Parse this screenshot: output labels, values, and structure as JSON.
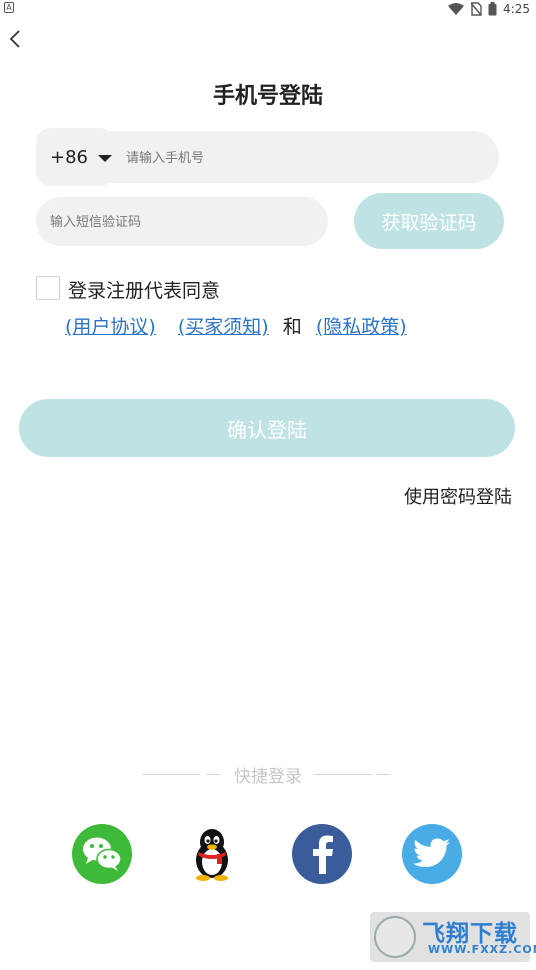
{
  "status_bar": {
    "left_badge": "A",
    "time": "4:25"
  },
  "page": {
    "title": "手机号登陆"
  },
  "phone": {
    "country_code": "+86",
    "placeholder": "请输入手机号"
  },
  "sms": {
    "placeholder": "输入短信验证码",
    "get_code_label": "获取验证码"
  },
  "agreement": {
    "checked": false,
    "text": "登录注册代表同意",
    "user_agreement": "(用户协议)",
    "buyer_notice": "(买家须知)",
    "conjunction": "和",
    "privacy_policy": "(隐私政策)"
  },
  "actions": {
    "confirm_label": "确认登陆",
    "password_login_label": "使用密码登陆"
  },
  "quick_login": {
    "label": "快捷登录",
    "providers": [
      "wechat",
      "qq",
      "facebook",
      "twitter"
    ]
  },
  "watermark": {
    "title": "飞翔下载",
    "subtitle": "WWW.FXXZ.COM"
  },
  "colors": {
    "accent_button": "#bfe3e5",
    "link": "#2b73c8",
    "wechat": "#3fb93a",
    "facebook": "#3b5c9a",
    "twitter": "#4aace6"
  }
}
